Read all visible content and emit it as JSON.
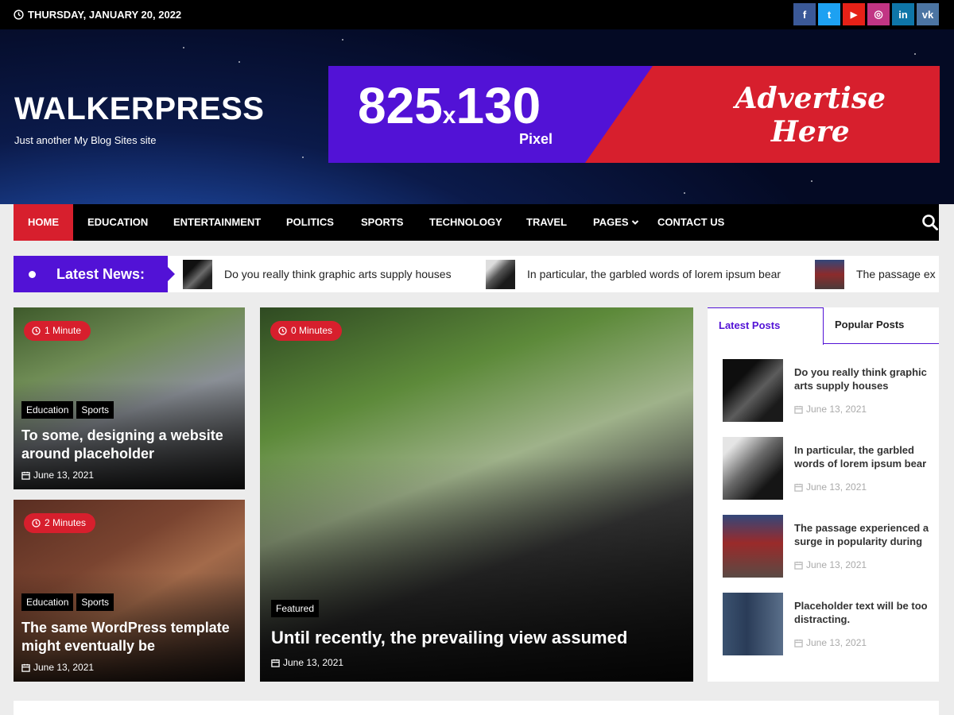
{
  "topbar": {
    "date": "THURSDAY, JANUARY 20, 2022",
    "social": [
      {
        "icon": "facebook-icon",
        "glyph": "f",
        "color": "#3b5998"
      },
      {
        "icon": "twitter-icon",
        "glyph": "t",
        "color": "#1da1f2"
      },
      {
        "icon": "youtube-icon",
        "glyph": "▶",
        "color": "#e62117"
      },
      {
        "icon": "instagram-icon",
        "glyph": "◎",
        "color": "#c13584"
      },
      {
        "icon": "linkedin-icon",
        "glyph": "in",
        "color": "#0e76a8"
      },
      {
        "icon": "vk-icon",
        "glyph": "vk",
        "color": "#4c75a3"
      }
    ]
  },
  "header": {
    "site_title": "WALKERPRESS",
    "tagline": "Just another My Blog Sites site",
    "ad": {
      "size": "825",
      "x": "x",
      "size2": "130",
      "unit": "Pixel",
      "line1": "Advertise",
      "line2": "Here"
    }
  },
  "nav": {
    "items": [
      "HOME",
      "EDUCATION",
      "ENTERTAINMENT",
      "POLITICS",
      "SPORTS",
      "TECHNOLOGY",
      "TRAVEL",
      "PAGES",
      "CONTACT US"
    ],
    "active": "HOME"
  },
  "ticker": {
    "label": "Latest News:",
    "items": [
      "Do you really think graphic arts supply houses",
      "In particular, the garbled words of lorem ipsum bear",
      "The passage ex"
    ]
  },
  "cards": {
    "card1": {
      "minutes": "1 Minute",
      "cats": [
        "Education",
        "Sports"
      ],
      "title": "To some, designing a website around placeholder",
      "date": "June 13, 2021"
    },
    "card2": {
      "minutes": "2 Minutes",
      "cats": [
        "Education",
        "Sports"
      ],
      "title": "The same WordPress template might eventually be",
      "date": "June 13, 2021"
    },
    "featured": {
      "minutes": "0 Minutes",
      "cats": [
        "Featured"
      ],
      "title": "Until recently, the prevailing view assumed",
      "date": "June 13, 2021"
    }
  },
  "sidebar": {
    "tabs": [
      "Latest Posts",
      "Popular Posts"
    ],
    "posts": [
      {
        "title": "Do you really think graphic arts supply houses",
        "date": "June 13, 2021"
      },
      {
        "title": "In particular, the garbled words of lorem ipsum bear",
        "date": "June 13, 2021"
      },
      {
        "title": "The passage experienced a surge in popularity during",
        "date": "June 13, 2021"
      },
      {
        "title": "Placeholder text will be too distracting.",
        "date": "June 13, 2021"
      }
    ]
  },
  "colors": {
    "accent": "#d71f2d",
    "brand": "#5212d6",
    "nav_bg": "#000000"
  }
}
